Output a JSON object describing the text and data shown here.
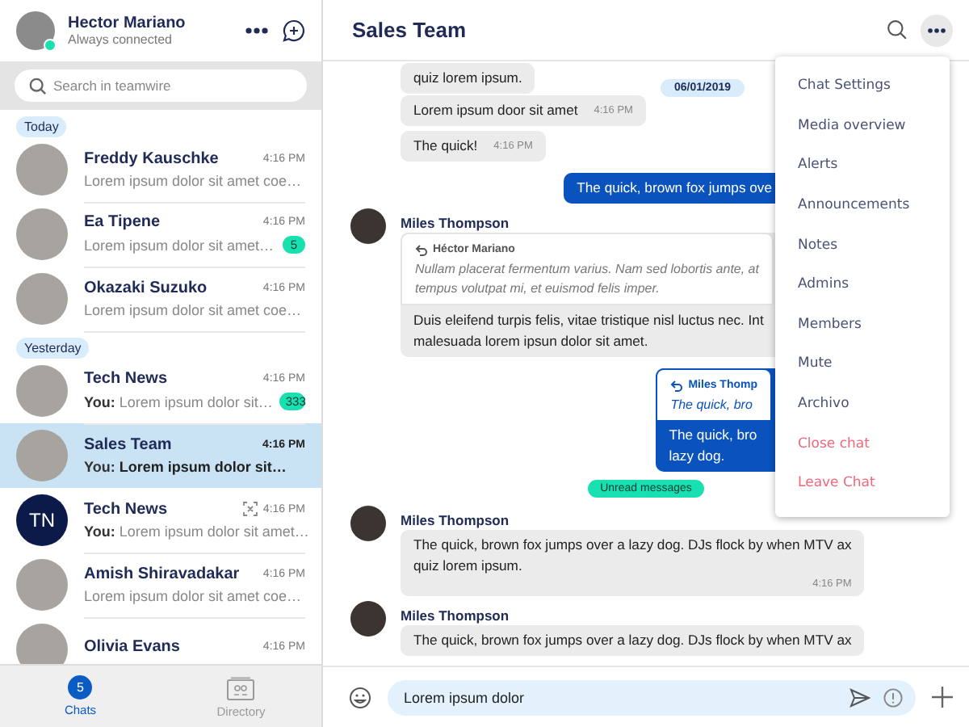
{
  "profile": {
    "name": "Hector Mariano",
    "status": "Always connected",
    "online": true
  },
  "search": {
    "placeholder": "Search in teamwire"
  },
  "chat_groups": [
    {
      "label": "Today",
      "chats": [
        {
          "name": "Freddy Kauschke",
          "time": "4:16 PM",
          "preview": "Lorem ipsum dolor sit amet coe…",
          "kind": "photo",
          "selected": false
        },
        {
          "name": "Ea Tipene",
          "time": "4:16 PM",
          "preview": "Lorem ipsum dolor sit amet…",
          "kind": "photo",
          "unread": "5",
          "selected": false
        },
        {
          "name": "Okazaki Suzuko",
          "time": "4:16 PM",
          "preview": "Lorem ipsum dolor sit amet coe…",
          "kind": "photo",
          "selected": false
        }
      ]
    },
    {
      "label": "Yesterday",
      "chats": [
        {
          "name": "Tech News",
          "time": "4:16 PM",
          "sender": "You:",
          "preview": "Lorem ipsum dolor sit…",
          "kind": "photo",
          "unread": "333",
          "selected": false
        },
        {
          "name": "Sales Team",
          "time": "4:16 PM",
          "sender": "You:",
          "preview": "Lorem ipsum dolor sit…",
          "kind": "photo",
          "selected": true
        },
        {
          "name": "Tech News",
          "time": "4:16 PM",
          "sender": "You:",
          "preview": "Lorem ipsum dolor sit amet…",
          "kind": "initials",
          "initials": "TN",
          "scan_icon": true,
          "selected": false
        },
        {
          "name": "Amish Shiravadakar",
          "time": "4:16 PM",
          "preview": "Lorem ipsum dolor sit amet coe…",
          "kind": "photo",
          "selected": false
        },
        {
          "name": "Olivia Evans",
          "time": "4:16 PM",
          "kind": "photo",
          "selected": false
        }
      ]
    }
  ],
  "bottom_nav": [
    {
      "label": "Chats",
      "badge": "5",
      "selected": true
    },
    {
      "label": "Directory",
      "selected": false
    }
  ],
  "chat": {
    "title": "Sales Team",
    "messages": [
      {
        "kind": "incoming",
        "text": "quiz lorem ipsum."
      },
      {
        "kind": "date",
        "text": "06/01/2019"
      },
      {
        "kind": "incoming",
        "text": "Lorem ipsum door sit amet",
        "time": "4:16 PM"
      },
      {
        "kind": "incoming",
        "text": "The quick!",
        "time": "4:16 PM"
      },
      {
        "kind": "outgoing",
        "text": "The quick, brown fox jumps ove"
      },
      {
        "kind": "incoming",
        "sender": "Miles Thompson",
        "quote": {
          "author": "Héctor Mariano",
          "text": "Nullam placerat fermentum varius. Nam sed lobortis ante, at\ntempus volutpat mi, et euismod felis imper."
        },
        "text": "Duis eleifend turpis felis, vitae tristique nisl luctus nec. Int\nmalesuada lorem ipsun dolor sit amet."
      },
      {
        "kind": "outgoing",
        "quote": {
          "author": "Miles Thomp",
          "text": "The quick, bro"
        },
        "text": "The quick, bro\nlazy dog."
      },
      {
        "kind": "unread",
        "text": "Unread messages"
      },
      {
        "kind": "incoming",
        "sender": "Miles Thompson",
        "text": "The quick, brown fox jumps over a lazy dog. DJs flock by when MTV ax\nquiz lorem ipsum.",
        "time": "4:16 PM"
      },
      {
        "kind": "incoming",
        "sender": "Miles Thompson",
        "text": "The quick, brown fox jumps over a lazy dog. DJs flock by when MTV ax"
      }
    ],
    "composer": {
      "value": "Lorem ipsum dolor"
    }
  },
  "menu": [
    {
      "label": "Chat Settings",
      "kind": "normal"
    },
    {
      "label": "Media overview",
      "kind": "normal"
    },
    {
      "label": "Alerts",
      "kind": "normal"
    },
    {
      "label": "Announcements",
      "kind": "normal"
    },
    {
      "label": "Notes",
      "kind": "normal"
    },
    {
      "label": "Admins",
      "kind": "normal"
    },
    {
      "label": "Members",
      "kind": "normal"
    },
    {
      "label": "Mute",
      "kind": "normal"
    },
    {
      "label": "Archivo",
      "kind": "normal"
    },
    {
      "label": "Close chat",
      "kind": "danger"
    },
    {
      "label": "Leave Chat",
      "kind": "danger"
    }
  ]
}
